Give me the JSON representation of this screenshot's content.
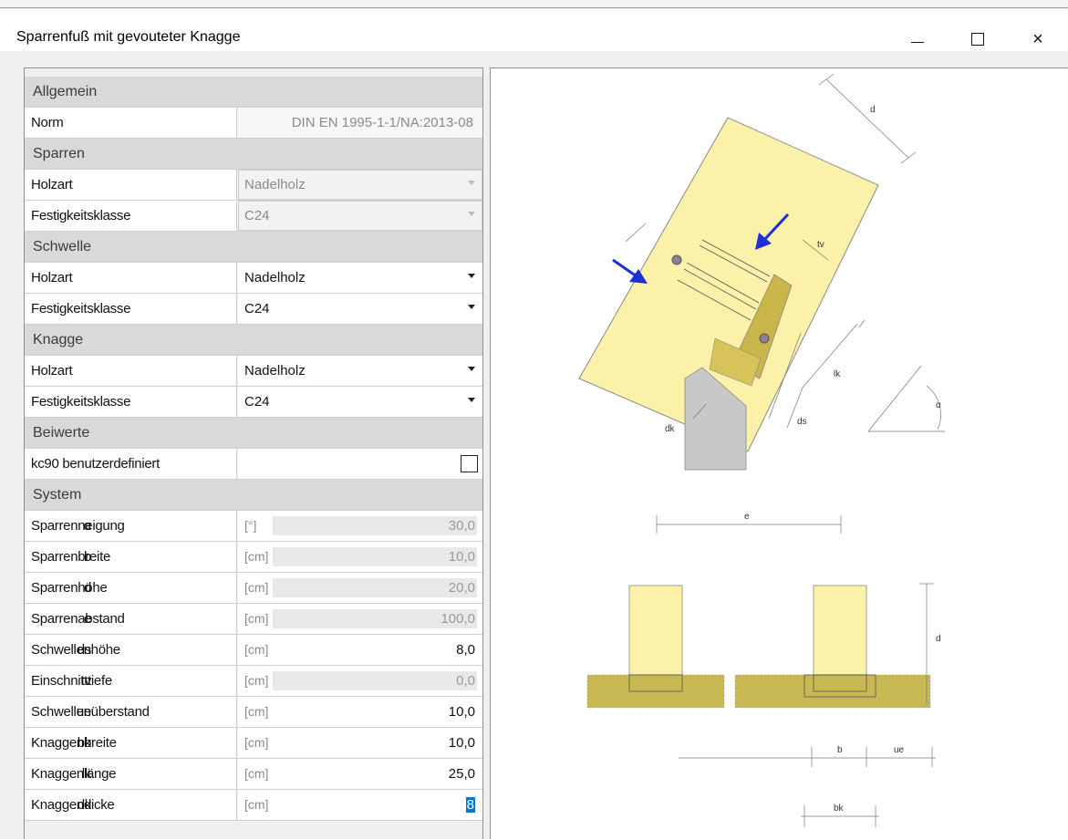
{
  "window": {
    "title": "Sparrenfuß mit gevouteter Knagge",
    "buttons": {
      "minimize": "minimize",
      "maximize": "maximize",
      "close": "×"
    }
  },
  "sections": {
    "allgemein": "Allgemein",
    "sparren": "Sparren",
    "schwelle": "Schwelle",
    "knagge": "Knagge",
    "beiwerte": "Beiwerte",
    "system": "System"
  },
  "props": {
    "norm": {
      "label": "Norm",
      "value": "DIN EN 1995-1-1/NA:2013-08"
    },
    "sparren_holzart": {
      "label": "Holzart",
      "value": "Nadelholz"
    },
    "sparren_festigkeit": {
      "label": "Festigkeitsklasse",
      "value": "C24"
    },
    "schwelle_holzart": {
      "label": "Holzart",
      "value": "Nadelholz"
    },
    "schwelle_festigkeit": {
      "label": "Festigkeitsklasse",
      "value": "C24"
    },
    "knagge_holzart": {
      "label": "Holzart",
      "value": "Nadelholz"
    },
    "knagge_festigkeit": {
      "label": "Festigkeitsklasse",
      "value": "C24"
    },
    "kc90": {
      "label": "kc90 benutzerdefiniert",
      "checked": false
    }
  },
  "system": [
    {
      "label": "Sparrenneigung",
      "symbol": "α",
      "unit": "[°]",
      "value": "30,0",
      "editable": false
    },
    {
      "label": "Sparrenbreite",
      "symbol": "b",
      "unit": "[cm]",
      "value": "10,0",
      "editable": false
    },
    {
      "label": "Sparrenhöhe",
      "symbol": "d",
      "unit": "[cm]",
      "value": "20,0",
      "editable": false
    },
    {
      "label": "Sparrenabstand",
      "symbol": "e",
      "unit": "[cm]",
      "value": "100,0",
      "editable": false
    },
    {
      "label": "Schwellenhöhe",
      "symbol": "ds",
      "unit": "[cm]",
      "value": "8,0",
      "editable": true
    },
    {
      "label": "Einschnitttiefe",
      "symbol": "tv",
      "unit": "[cm]",
      "value": "0,0",
      "editable": false
    },
    {
      "label": "Schwellenüberstand",
      "symbol": "ue",
      "unit": "[cm]",
      "value": "10,0",
      "editable": true
    },
    {
      "label": "Knaggenbreite",
      "symbol": "bk",
      "unit": "[cm]",
      "value": "10,0",
      "editable": true
    },
    {
      "label": "Knaggenlänge",
      "symbol": "lk",
      "unit": "[cm]",
      "value": "25,0",
      "editable": true
    },
    {
      "label": "Knaggendicke",
      "symbol": "dk",
      "unit": "[cm]",
      "value": "8",
      "editable": true,
      "selected": true
    }
  ],
  "drawing_labels": {
    "d_top": "d",
    "tv": "tv",
    "lk": "lk",
    "ds": "ds",
    "dk": "dk",
    "alpha": "α",
    "e": "e",
    "d_side": "d",
    "b": "b",
    "ue": "ue",
    "bk": "bk"
  },
  "colors": {
    "timber": "#fbf1a8",
    "cleat": "#c9b54a",
    "sill": "#c7b853",
    "support": "#c8c8c8",
    "arrow": "#1e2fd6",
    "section_bg": "#d9d9d9"
  }
}
